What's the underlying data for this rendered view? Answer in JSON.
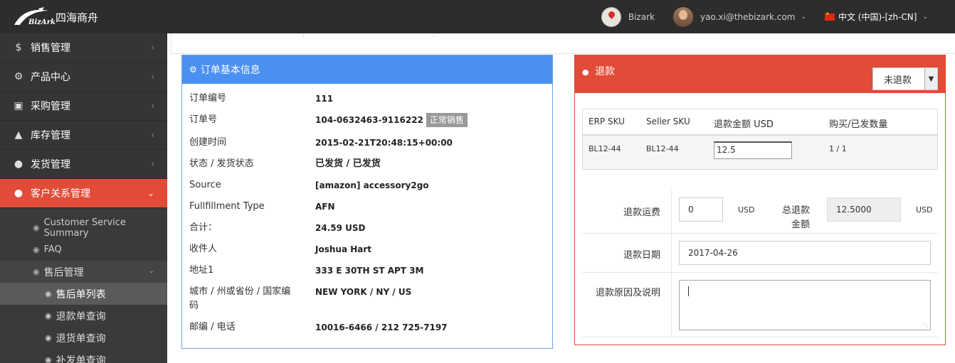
{
  "app": {
    "brand_logo_text": "BizArk",
    "brand_name": "四海商舟"
  },
  "topnav": {
    "store_name": "Bizark",
    "user_email": "yao.xi@thebizark.com",
    "language": "中文 (中国)-[zh-CN]"
  },
  "sidebar": {
    "items": [
      {
        "label": "销售管理",
        "icon": "dollar-icon"
      },
      {
        "label": "产品中心",
        "icon": "cogs-icon"
      },
      {
        "label": "采购管理",
        "icon": "cube-icon"
      },
      {
        "label": "库存管理",
        "icon": "android-icon"
      },
      {
        "label": "发货管理",
        "icon": "circle-icon"
      },
      {
        "label": "客户关系管理",
        "icon": "circle-icon"
      }
    ],
    "sub_items": [
      {
        "label": "Customer Service Summary"
      },
      {
        "label": "FAQ"
      },
      {
        "label": "售后管理"
      }
    ],
    "subsub_items": [
      {
        "label": "售后单列表"
      },
      {
        "label": "退款单查询"
      },
      {
        "label": "退货单查询"
      },
      {
        "label": "补发单查询"
      }
    ]
  },
  "order": {
    "title": "订单基本信息",
    "rows": [
      {
        "label": "订单编号",
        "value": "111"
      },
      {
        "label": "订单号",
        "value": "104-0632463-9116222",
        "badge": "正常销售"
      },
      {
        "label": "创建时间",
        "value": "2015-02-21T20:48:15+00:00"
      },
      {
        "label": "状态 / 发货状态",
        "value": "已发货 / 已发货"
      },
      {
        "label": "Source",
        "value": "[amazon] accessory2go"
      },
      {
        "label": "Fullfillment Type",
        "value": "AFN"
      },
      {
        "label": "合计：",
        "value": "24.59 USD"
      },
      {
        "label": "收件人",
        "value": "Joshua Hart"
      },
      {
        "label": "地址1",
        "value": "333 E 30TH ST APT 3M"
      },
      {
        "label": "城市 / 州或省份 / 国家编码",
        "value": "NEW YORK / NY / US"
      },
      {
        "label": "邮编 / 电话",
        "value": "10016-6466 / 212 725-7197"
      }
    ]
  },
  "refund": {
    "title": "退款",
    "status_selected": "未退款",
    "table": {
      "headers": [
        "ERP SKU",
        "Seller SKU",
        "退款金额 USD",
        "购买/已发数量"
      ],
      "rows": [
        {
          "erp_sku": "BL12-44",
          "seller_sku": "BL12-44",
          "amount": "12.5",
          "qty": "1 / 1"
        }
      ]
    },
    "shipping_label": "退款运费",
    "shipping_value": "0",
    "shipping_unit": "USD",
    "total_label": "总退款金额",
    "total_value": "12.5000",
    "total_unit": "USD",
    "date_label": "退款日期",
    "date_value": "2017-04-26",
    "reason_label": "退款原因及说明",
    "reason_value": ""
  }
}
